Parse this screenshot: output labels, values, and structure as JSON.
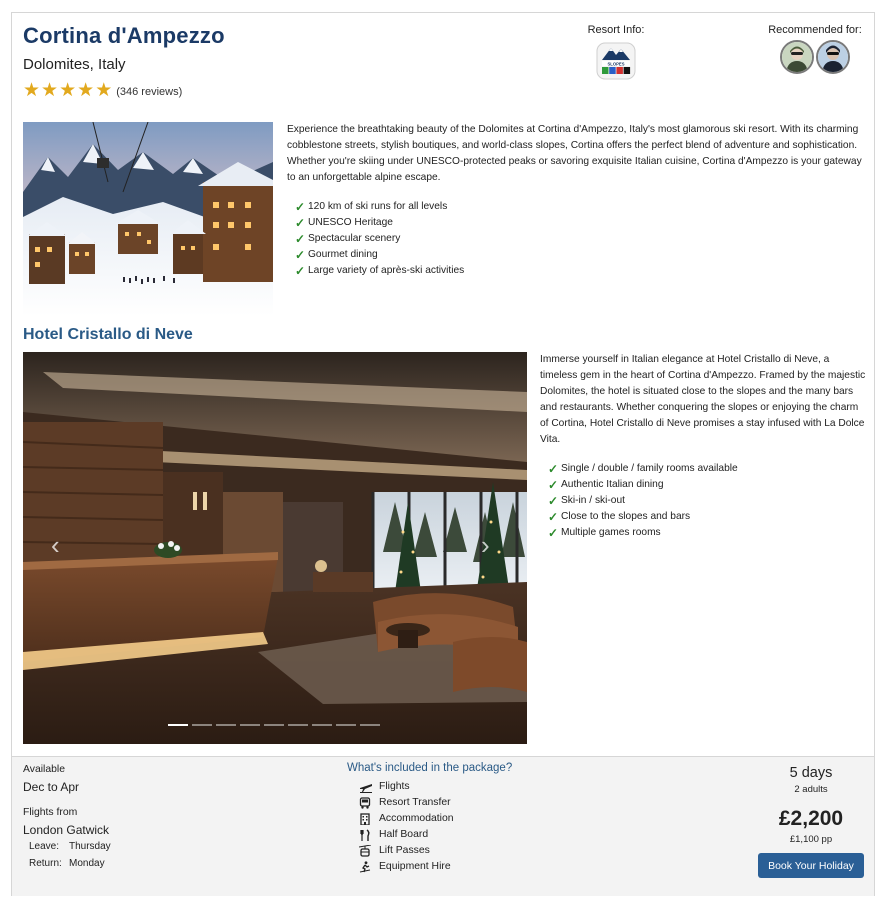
{
  "resort": {
    "name": "Cortina d'Ampezzo",
    "location": "Dolomites, Italy",
    "stars": 5,
    "reviews": "(346 reviews)",
    "resort_info_label": "Resort Info:",
    "slopes_badge_text": "SLOPES",
    "recommended_label": "Recommended for:",
    "description": "Experience the breathtaking beauty of the Dolomites at Cortina d'Ampezzo, Italy's most glamorous ski resort. With its charming cobblestone streets, stylish boutiques, and world-class slopes, Cortina offers the perfect blend of adventure and sophistication. Whether you're skiing under UNESCO-protected peaks or savoring exquisite Italian cuisine, Cortina d'Ampezzo is your gateway to an unforgettable alpine escape.",
    "features": [
      "120 km of ski runs for all levels",
      "UNESCO Heritage",
      "Spectacular scenery",
      "Gourmet dining",
      "Large variety of après-ski activities"
    ]
  },
  "hotel": {
    "name": "Hotel Cristallo di Neve",
    "description": "Immerse yourself in Italian elegance at Hotel Cristallo di Neve, a timeless gem in the heart of Cortina d'Ampezzo. Framed by the majestic Dolomites, the hotel is situated close to the slopes and the many bars and restaurants. Whether conquering the slopes or enjoying the charm of Cortina, Hotel Cristallo di Neve promises a stay infused with La Dolce Vita.",
    "features": [
      "Single / double / family rooms available",
      "Authentic Italian dining",
      "Ski-in / ski-out",
      "Close to the slopes and bars",
      "Multiple games rooms"
    ],
    "gallery": {
      "count": 9,
      "active_index": 0
    }
  },
  "package": {
    "available_label": "Available",
    "available_value": "Dec to Apr",
    "flights_from_label": "Flights from",
    "flights_from_value": "London Gatwick",
    "leave_label": "Leave:",
    "leave_value": "Thursday",
    "return_label": "Return:",
    "return_value": "Monday",
    "included_heading": "What's included in the package?",
    "included": [
      {
        "label": "Flights",
        "icon": "plane-icon"
      },
      {
        "label": "Resort Transfer",
        "icon": "bus-icon"
      },
      {
        "label": "Accommodation",
        "icon": "hotel-icon"
      },
      {
        "label": "Half Board",
        "icon": "cutlery-icon"
      },
      {
        "label": "Lift Passes",
        "icon": "gondola-icon"
      },
      {
        "label": "Equipment Hire",
        "icon": "skier-icon"
      }
    ],
    "duration": "5 days",
    "adults": "2 adults",
    "price": "£2,200",
    "price_pp": "£1,100 pp",
    "book_label": "Book Your Holiday"
  },
  "colors": {
    "title": "#1b3a66",
    "accent": "#2a5a86",
    "button": "#2a5f96",
    "star": "#e2a91e",
    "check": "#2c8a2c"
  }
}
